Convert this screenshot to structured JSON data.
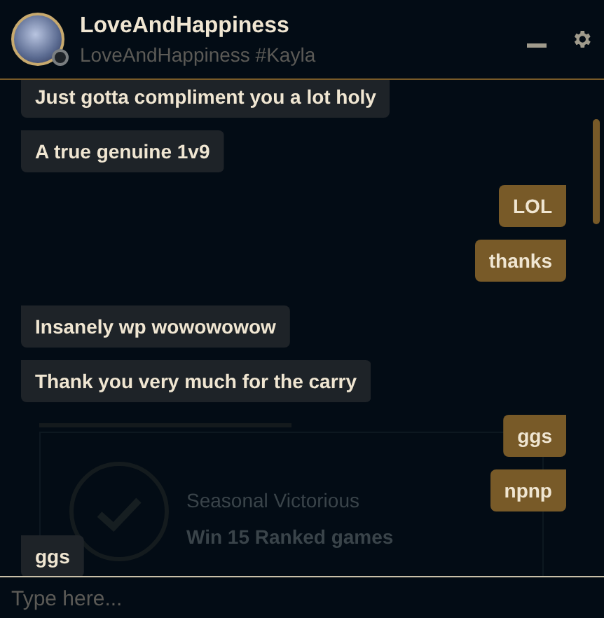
{
  "header": {
    "name": "LoveAndHappiness",
    "subtitle": "LoveAndHappiness #Kayla"
  },
  "background_card": {
    "title": "Seasonal Victorious",
    "description": "Win 15 Ranked games"
  },
  "messages": [
    {
      "kind": "incoming",
      "text": "Just gotta compliment you a lot holy"
    },
    {
      "kind": "incoming",
      "text": "A true genuine 1v9"
    },
    {
      "kind": "outgoing",
      "text": "LOL"
    },
    {
      "kind": "outgoing",
      "text": "thanks"
    },
    {
      "kind": "incoming",
      "text": "Insanely wp wowowowow"
    },
    {
      "kind": "incoming",
      "text": "Thank you very much for the carry"
    },
    {
      "kind": "outgoing",
      "text": "ggs"
    },
    {
      "kind": "outgoing",
      "text": "npnp"
    },
    {
      "kind": "incoming",
      "text": "ggs"
    }
  ],
  "input": {
    "placeholder": "Type here..."
  }
}
